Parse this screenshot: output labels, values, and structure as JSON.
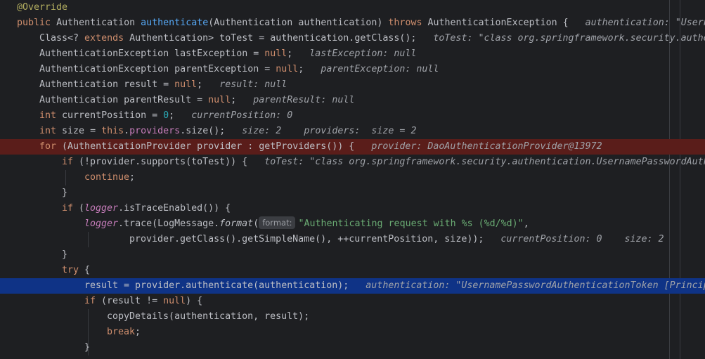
{
  "code": {
    "annotation": "@Override",
    "method_signature": {
      "public": "public",
      "return_type": "Authentication",
      "name": "authenticate",
      "params": "(Authentication authentication)",
      "throws": "throws",
      "exception": "AuthenticationException {",
      "hint": "authentication: \"UsernamePasswordAuthenticationToken [Principal="
    },
    "line_totest": {
      "text1": "Class<? ",
      "extends": "extends",
      "text2": " Authentication> toTest = authentication.getClass();",
      "hint": "toTest: \"class org.springframework.security.authentication.UsernamePasswordAuthenticationToken\""
    },
    "line_lastexception": {
      "text": "AuthenticationException lastException = ",
      "null": "null",
      "semi": ";",
      "hint": "lastException: null"
    },
    "line_parentexception": {
      "text": "AuthenticationException parentException = ",
      "null": "null",
      "semi": ";",
      "hint": "parentException: null"
    },
    "line_result": {
      "text": "Authentication result = ",
      "null": "null",
      "semi": ";",
      "hint": "result: null"
    },
    "line_parentresult": {
      "text": "Authentication parentResult = ",
      "null": "null",
      "semi": ";",
      "hint": "parentResult: null"
    },
    "line_currentposition": {
      "int": "int",
      "text": " currentPosition = ",
      "zero": "0",
      "semi": ";",
      "hint": "currentPosition: 0"
    },
    "line_size": {
      "int": "int",
      "text1": " size = ",
      "this": "this",
      "dot": ".",
      "providers": "providers",
      "text2": ".size();",
      "hint1": "size: 2",
      "hint2": "providers:  size = 2"
    },
    "line_for": {
      "for": "for",
      "text": " (AuthenticationProvider provider : getProviders()) {",
      "hint": "provider: DaoAuthenticationProvider@13972"
    },
    "line_if_supports": {
      "if": "if",
      "text": " (!provider.supports(toTest)) {",
      "hint": "toTest: \"class org.springframework.security.authentication.UsernamePasswordAuthenticationToken\""
    },
    "line_continue": {
      "continue": "continue",
      "semi": ";"
    },
    "brace_close": "}",
    "line_if_trace": {
      "if": "if",
      "text1": " (",
      "logger": "logger",
      "text2": ".isTraceEnabled()) {"
    },
    "line_trace": {
      "logger": "logger",
      "text1": ".trace(LogMessage.",
      "format": "format",
      "text2": "(",
      "param_hint": "format:",
      "string": "\"Authenticating request with %s (%d/%d)\"",
      "comma": ","
    },
    "line_trace_args": {
      "text": "provider.getClass().getSimpleName(), ++currentPosition, size));",
      "hint1": "currentPosition: 0",
      "hint2": "size: 2"
    },
    "line_try": {
      "try": "try",
      "text": " {"
    },
    "line_authenticate": {
      "text": "result = provider.authenticate(authentication);",
      "hint": "authentication: \"UsernamePasswordAuthenticationToken [Principal="
    },
    "line_if_result": {
      "if": "if",
      "text1": " (result != ",
      "null": "null",
      "text2": ") {"
    },
    "line_copydetails": {
      "text": "copyDetails(authentication, result);"
    },
    "line_break": {
      "break": "break",
      "semi": ";"
    }
  }
}
